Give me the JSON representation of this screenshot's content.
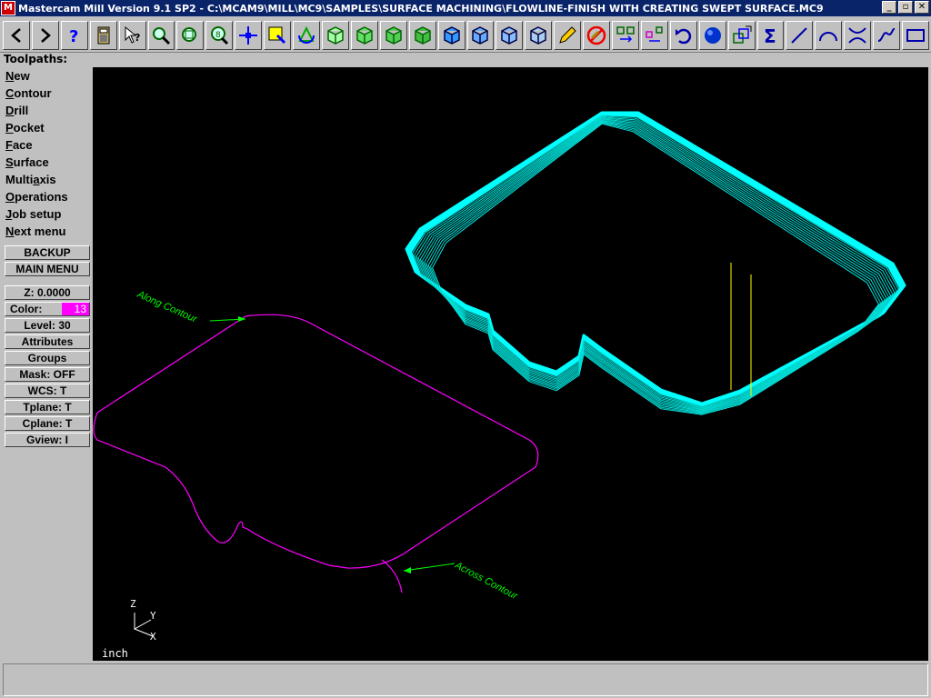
{
  "window": {
    "title": "Mastercam Mill Version 9.1 SP2 - C:\\MCAM9\\MILL\\MC9\\SAMPLES\\SURFACE MACHINING\\FLOWLINE-FINISH WITH CREATING SWEPT SURFACE.MC9",
    "minimize": "_",
    "restore": "▫",
    "close": "✕"
  },
  "toolbar": {
    "icons": [
      "back-arrow-icon",
      "forward-arrow-icon",
      "help-icon",
      "calculator-icon",
      "whats-this-icon",
      "zoom-window-icon",
      "zoom-out-icon",
      "zoom-level-icon",
      "pan-icon",
      "select-icon",
      "rotate-icon",
      "view-iso-icon",
      "view-top-icon",
      "view-front-icon",
      "view-side-icon",
      "view-cube-a-icon",
      "view-cube-b-icon",
      "view-cube-c-icon",
      "view-cube-d-icon",
      "pencil-icon",
      "delete-icon",
      "xform-icon",
      "transform-icon",
      "undo-icon",
      "shade-icon",
      "layers-icon",
      "sum-icon",
      "line-icon",
      "arc-icon",
      "trim-icon",
      "spline-icon",
      "rectangle-icon"
    ]
  },
  "menu": {
    "heading": "Toolpaths:",
    "items": [
      {
        "key": "N",
        "rest": "ew"
      },
      {
        "key": "C",
        "rest": "ontour"
      },
      {
        "key": "D",
        "rest": "rill"
      },
      {
        "key": "P",
        "rest": "ocket"
      },
      {
        "key": "F",
        "rest": "ace"
      },
      {
        "key": "S",
        "rest": "urface"
      },
      {
        "pre": "Multi",
        "key": "a",
        "rest": "xis"
      },
      {
        "key": "O",
        "rest": "perations"
      },
      {
        "key": "J",
        "rest": "ob setup"
      },
      {
        "key": "N",
        "rest": "ext menu"
      }
    ],
    "backup": "BACKUP",
    "main_menu": "MAIN MENU"
  },
  "status": {
    "z": "Z:  0.0000",
    "color_label": "Color:",
    "color_value": "13",
    "level": "Level: 30",
    "attributes": "Attributes",
    "groups": "Groups",
    "mask": "Mask:  OFF",
    "wcs": "WCS:   T",
    "tplane": "Tplane:  T",
    "cplane": "Cplane:  T",
    "gview": "Gview:   I"
  },
  "viewport": {
    "units": "inch",
    "axis_z": "Z",
    "axis_y": "Y",
    "axis_x": "X",
    "label_along": "Along Contour",
    "label_across": "Across Contour",
    "toolpath_color": "#00ffff",
    "contour_color": "#ff00ff",
    "annotation_color": "#00ff00"
  }
}
